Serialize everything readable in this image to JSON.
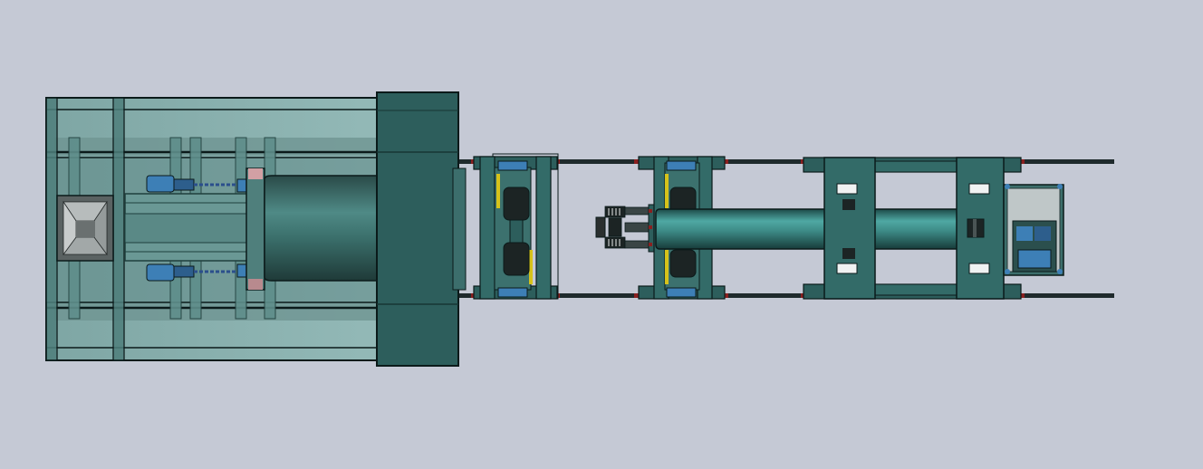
{
  "scene": {
    "background": "#c5c9d5",
    "colors": {
      "steel_dark": "#2d5e5c",
      "steel_mid": "#336b68",
      "steel_light": "#5f9a97",
      "glass": "#8fb5b3",
      "glass_dark": "#6f9592",
      "outline": "#0b1a1a",
      "rail": "#1f2a2c",
      "rail_joint": "#8a2020",
      "motor_blue": "#3d7fb6",
      "accent_yellow": "#d6c21a",
      "roller_black": "#1c2424",
      "seal_pink": "#d2a0a4"
    }
  },
  "components": [
    {
      "name": "furnace-enclosure",
      "icon": "glass-enclosure"
    },
    {
      "name": "feed-hopper",
      "icon": "hopper-icon"
    },
    {
      "name": "drive-motor-upper",
      "icon": "motor-icon"
    },
    {
      "name": "drive-motor-lower",
      "icon": "motor-icon"
    },
    {
      "name": "rotary-drum",
      "icon": "cylinder-icon"
    },
    {
      "name": "end-block",
      "icon": "block-icon"
    },
    {
      "name": "pinch-roller-carriage-1",
      "icon": "roller-icon"
    },
    {
      "name": "gripper-head",
      "icon": "gripper-icon"
    },
    {
      "name": "pinch-roller-carriage-2",
      "icon": "roller-icon"
    },
    {
      "name": "extracted-pipe",
      "icon": "cylinder-icon"
    },
    {
      "name": "outfeed-frame",
      "icon": "frame-icon"
    },
    {
      "name": "control-cabinet",
      "icon": "cabinet-icon"
    },
    {
      "name": "guide-rails",
      "icon": "rail-icon"
    }
  ]
}
